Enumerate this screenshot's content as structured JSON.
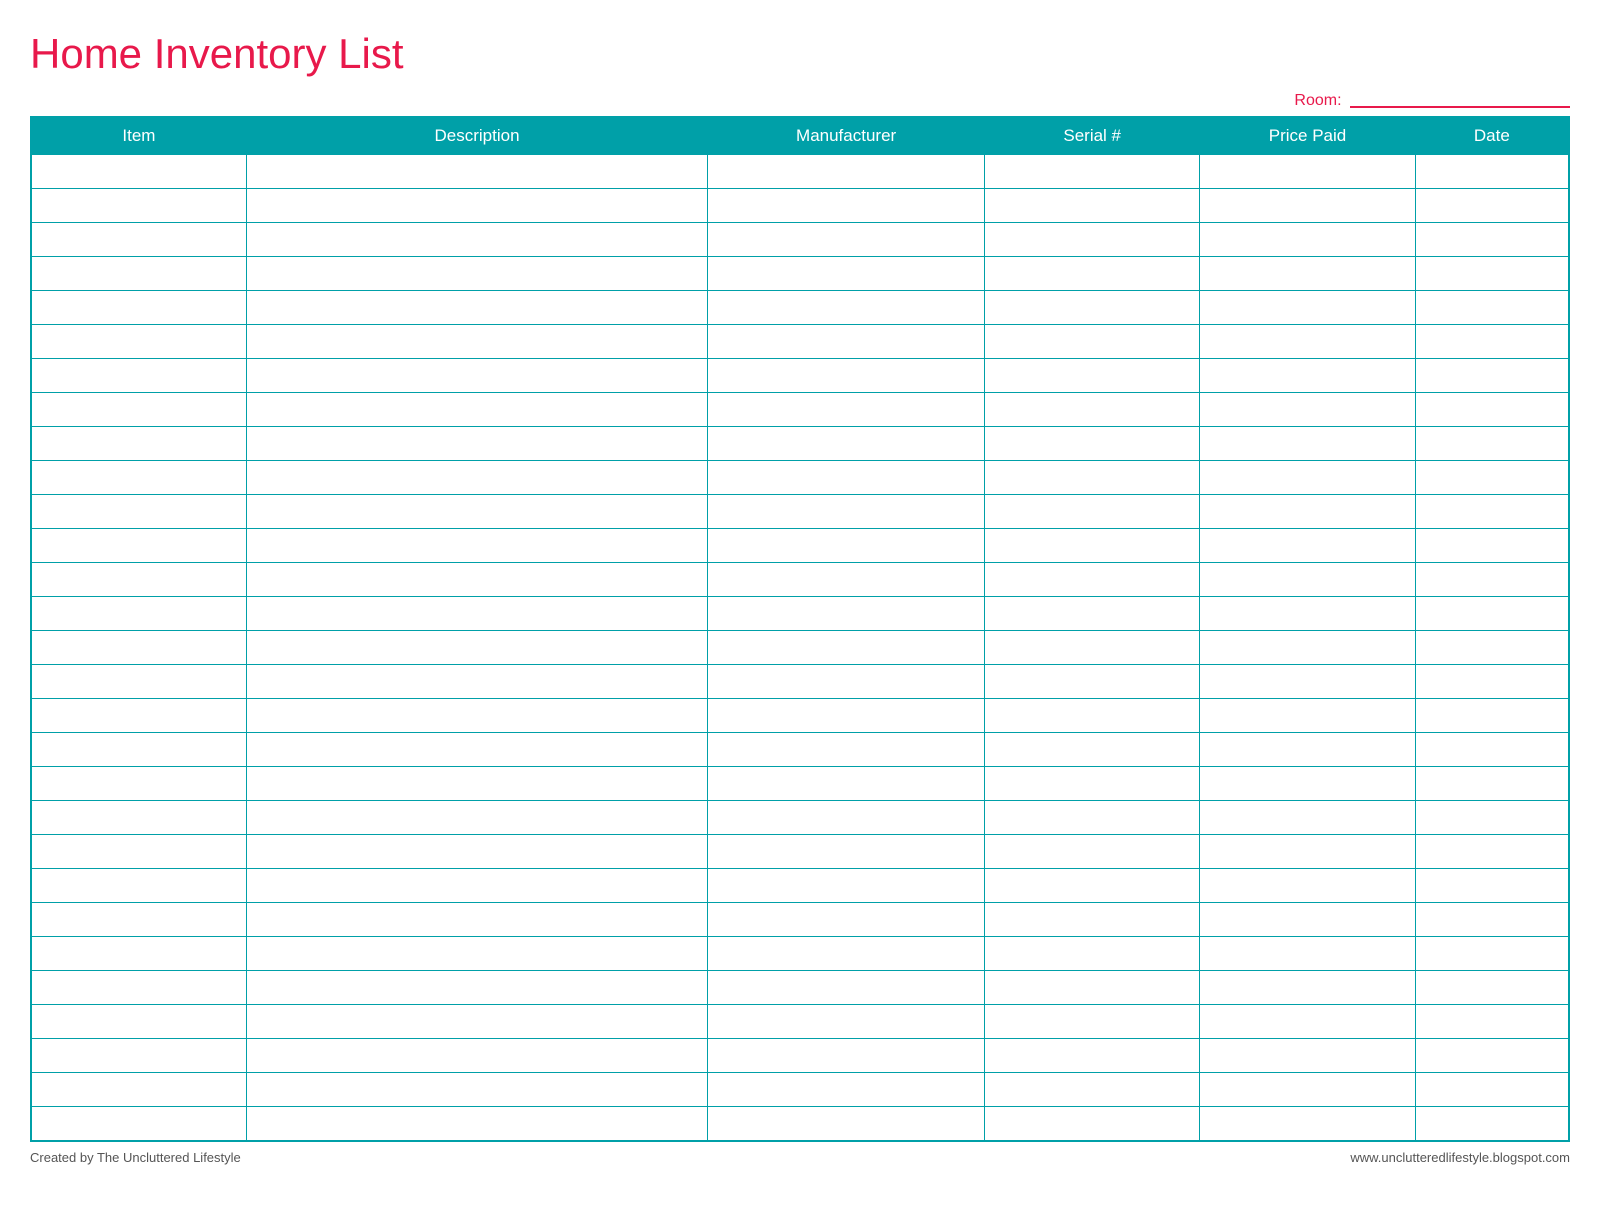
{
  "page": {
    "title": "Home Inventory List",
    "room_label": "Room:",
    "footer_left": "Created by The Uncluttered Lifestyle",
    "footer_right": "www.unclutteredlifestyle.blogspot.com"
  },
  "table": {
    "columns": [
      {
        "key": "item",
        "label": "Item"
      },
      {
        "key": "description",
        "label": "Description"
      },
      {
        "key": "manufacturer",
        "label": "Manufacturer"
      },
      {
        "key": "serial",
        "label": "Serial #"
      },
      {
        "key": "price",
        "label": "Price Paid"
      },
      {
        "key": "date",
        "label": "Date"
      }
    ],
    "row_count": 29
  },
  "colors": {
    "title": "#e8194b",
    "teal": "#00a0a8",
    "room_line": "#e8194b"
  }
}
